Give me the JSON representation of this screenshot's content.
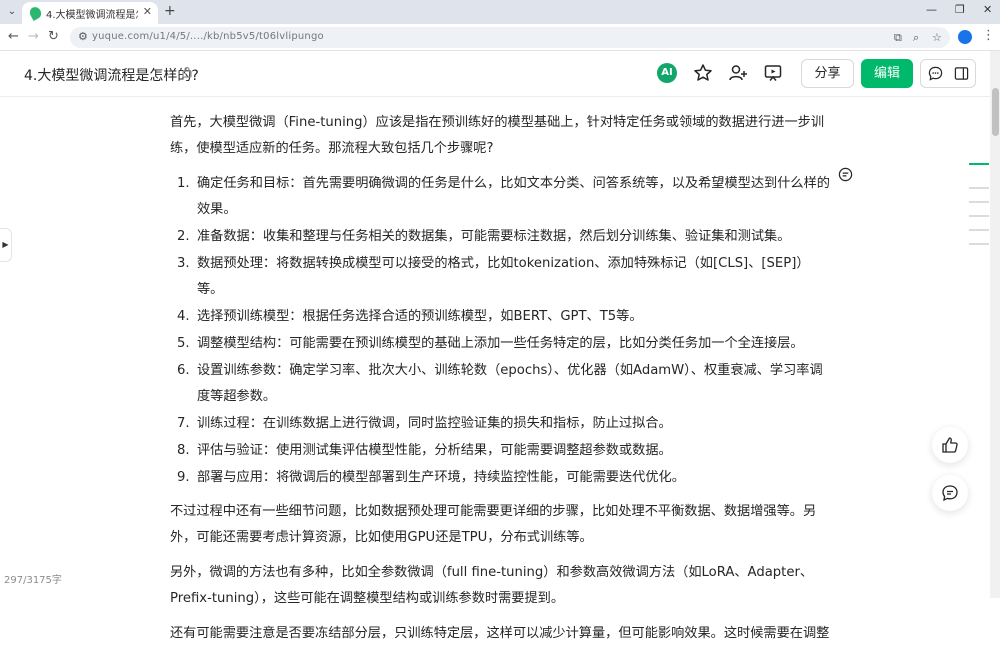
{
  "browser": {
    "tab_title": "4.大模型微调流程是怎样的?",
    "url": "yuque.com/u1/4/5/..../kb/nb5v5/t06lvlipungo"
  },
  "header": {
    "doc_title": "4.大模型微调流程是怎样的?",
    "ai_label": "AI",
    "share_label": "分享",
    "edit_label": "编辑",
    "accent_color": "#00b96b"
  },
  "content": {
    "intro": "首先，大模型微调（Fine-tuning）应该是指在预训练好的模型基础上，针对特定任务或领域的数据进行进一步训练，使模型适应新的任务。那流程大致包括几个步骤呢?",
    "steps": [
      {
        "num": "1.",
        "text": "确定任务和目标：首先需要明确微调的任务是什么，比如文本分类、问答系统等，以及希望模型达到什么样的效果。"
      },
      {
        "num": "2.",
        "text": "准备数据：收集和整理与任务相关的数据集，可能需要标注数据，然后划分训练集、验证集和测试集。"
      },
      {
        "num": "3.",
        "text": "数据预处理：将数据转换成模型可以接受的格式，比如tokenization、添加特殊标记（如[CLS]、[SEP]）等。"
      },
      {
        "num": "4.",
        "text": "选择预训练模型：根据任务选择合适的预训练模型，如BERT、GPT、T5等。"
      },
      {
        "num": "5.",
        "text": "调整模型结构：可能需要在预训练模型的基础上添加一些任务特定的层，比如分类任务加一个全连接层。"
      },
      {
        "num": "6.",
        "text": "设置训练参数：确定学习率、批次大小、训练轮数（epochs）、优化器（如AdamW）、权重衰减、学习率调度等超参数。"
      },
      {
        "num": "7.",
        "text": "训练过程：在训练数据上进行微调，同时监控验证集的损失和指标，防止过拟合。"
      },
      {
        "num": "8.",
        "text": "评估与验证：使用测试集评估模型性能，分析结果，可能需要调整超参数或数据。"
      },
      {
        "num": "9.",
        "text": "部署与应用：将微调后的模型部署到生产环境，持续监控性能，可能需要迭代优化。"
      }
    ],
    "para2": "不过过程中还有一些细节问题，比如数据预处理可能需要更详细的步骤，比如处理不平衡数据、数据增强等。另外，可能还需要考虑计算资源，比如使用GPU还是TPU，分布式训练等。",
    "para3": "另外，微调的方法也有多种，比如全参数微调（full fine-tuning）和参数高效微调方法（如LoRA、Adapter、Prefix-tuning），这些可能在调整模型结构或训练参数时需要提到。",
    "para4": "还有可能需要注意是否要冻结部分层，只训练特定层，这样可以减少计算量，但可能影响效果。这时候需要在调整"
  },
  "footer": {
    "word_count": "297/3175字"
  }
}
